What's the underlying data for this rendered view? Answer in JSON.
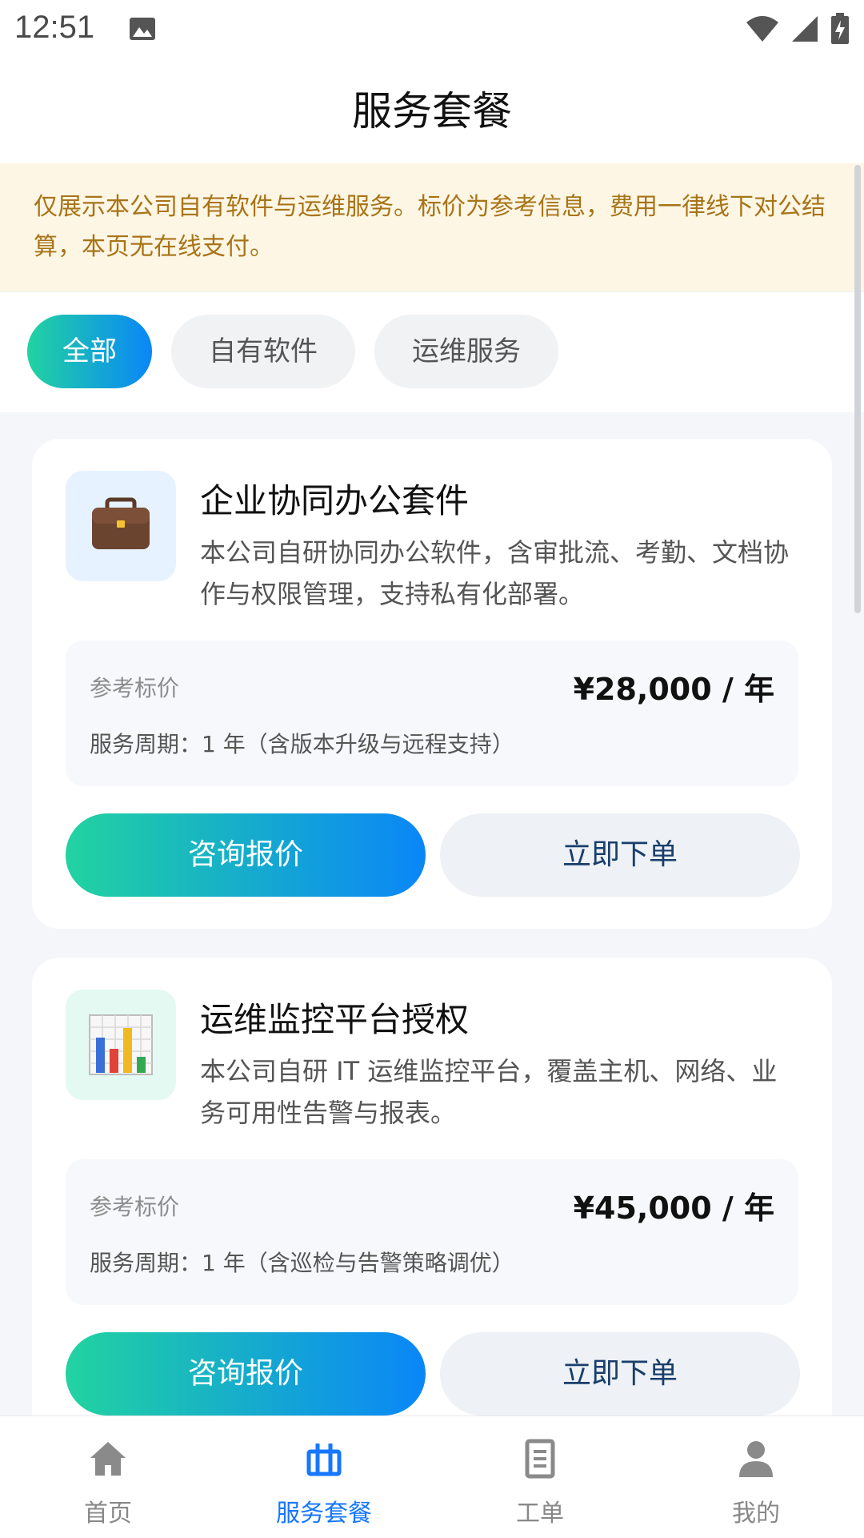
{
  "status_bar": {
    "time": "12:51"
  },
  "header": {
    "title": "服务套餐"
  },
  "notice": {
    "text": "仅展示本公司自有软件与运维服务。标价为参考信息，费用一律线下对公结算，本页无在线支付。"
  },
  "filters": {
    "all": "全部",
    "software": "自有软件",
    "ops": "运维服务",
    "active": "全部"
  },
  "cards": [
    {
      "title": "企业协同办公套件",
      "description": "本公司自研协同办公软件，含审批流、考勤、文档协作与权限管理，支持私有化部署。",
      "price_label": "参考标价",
      "price": "¥28,000 / 年",
      "period": "服务周期：1 年（含版本升级与远程支持）",
      "consult_label": "咨询报价",
      "order_label": "立即下单",
      "icon": "briefcase-icon"
    },
    {
      "title": "运维监控平台授权",
      "description": "本公司自研 IT 运维监控平台，覆盖主机、网络、业务可用性告警与报表。",
      "price_label": "参考标价",
      "price": "¥45,000 / 年",
      "period": "服务周期：1 年（含巡检与告警策略调优）",
      "consult_label": "咨询报价",
      "order_label": "立即下单",
      "icon": "bar-chart-icon"
    }
  ],
  "tabbar": {
    "items": [
      {
        "label": "首页",
        "icon": "home-icon"
      },
      {
        "label": "服务套餐",
        "icon": "package-icon"
      },
      {
        "label": "工单",
        "icon": "document-icon"
      },
      {
        "label": "我的",
        "icon": "person-icon"
      }
    ],
    "active": "服务套餐"
  },
  "colors": {
    "accent_start": "#22d3a0",
    "accent_end": "#0a86f8",
    "active_tab": "#1677ff",
    "notice_text": "#a87418"
  }
}
